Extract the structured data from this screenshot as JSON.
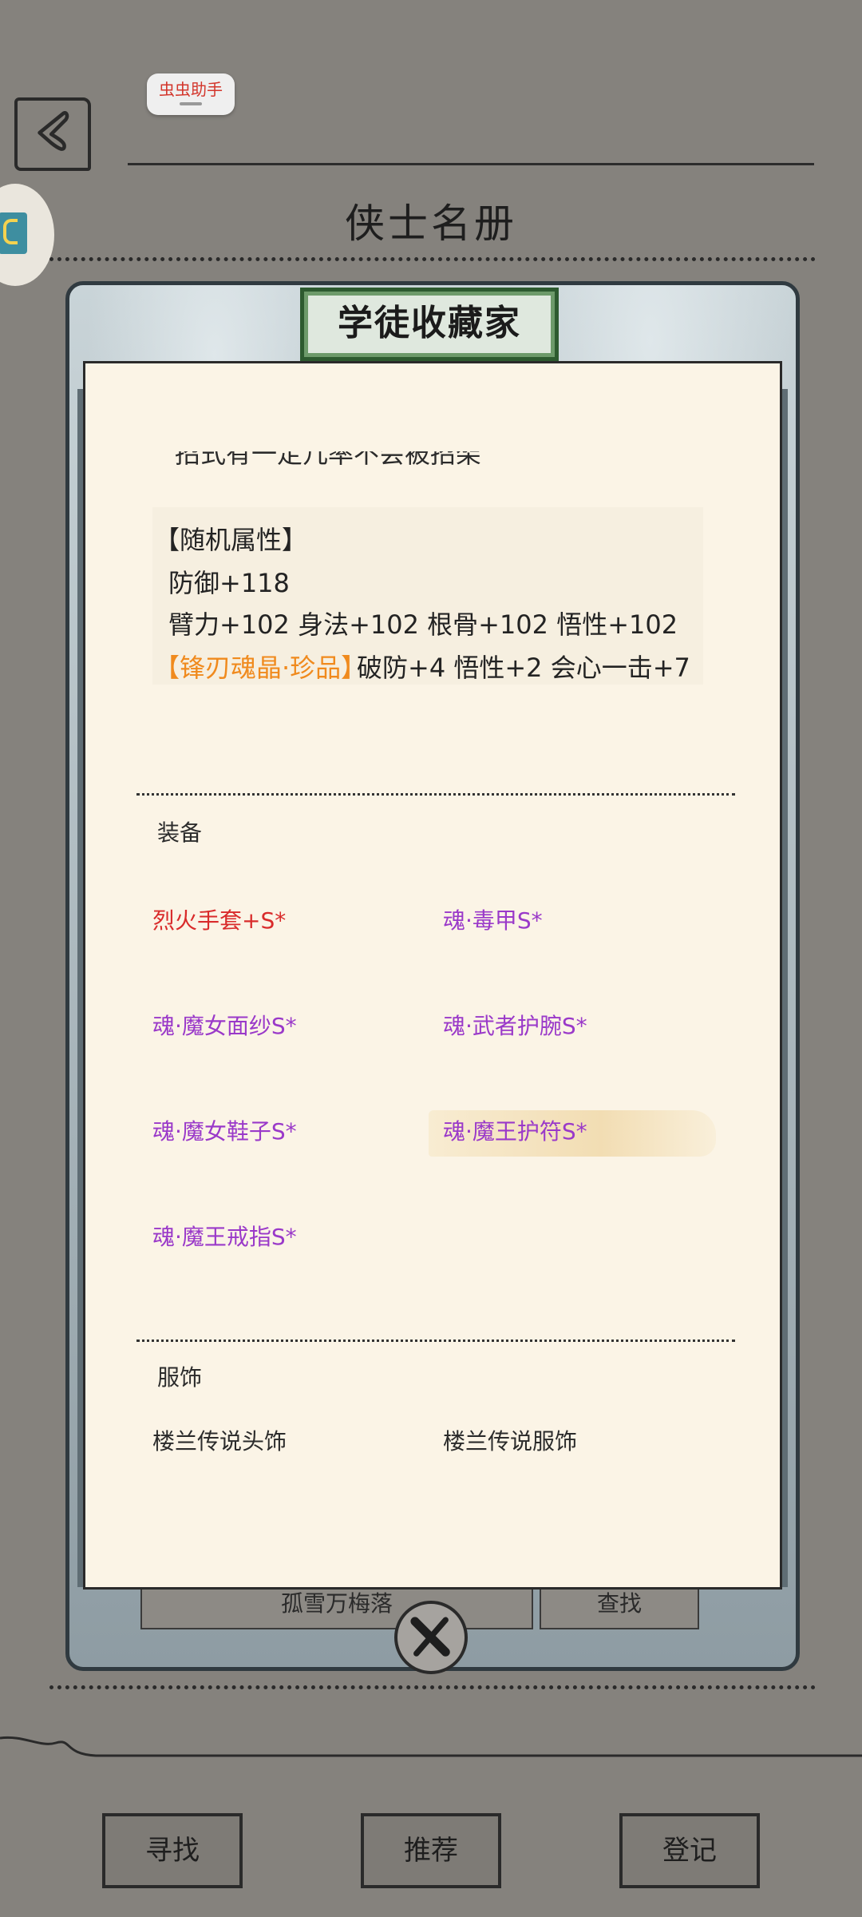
{
  "helper": {
    "label": "虫虫助手"
  },
  "header": {
    "title": "侠士名册"
  },
  "modal": {
    "title": "学徒收藏家",
    "cut_text": "招式有一定几率不会被招架",
    "random_attr": {
      "heading": "【随机属性】",
      "defense": "防御+118",
      "stats": "臂力+102 身法+102 根骨+102 悟性+102",
      "gem_name": "【锋刃魂晶·珍品】",
      "gem_effect": "破防+4 悟性+2 会心一击+7"
    },
    "equipment": {
      "label": "装备",
      "items": [
        "烈火手套+S*",
        "魂·毒甲S*",
        "魂·魔女面纱S*",
        "魂·武者护腕S*",
        "魂·魔女鞋子S*",
        "魂·魔王护符S*",
        "魂·魔王戒指S*"
      ]
    },
    "clothing": {
      "label": "服饰",
      "items": [
        "楼兰传说头饰",
        "楼兰传说服饰"
      ]
    }
  },
  "search": {
    "value": "孤雪万梅落",
    "button": "查找"
  },
  "bottom_nav": {
    "find": "寻找",
    "recommend": "推荐",
    "register": "登记"
  },
  "colors": {
    "background": "#85827d",
    "paper": "#fbf4e6",
    "orange": "#f08a1d",
    "purple": "#9a39c9",
    "red": "#d92b2b"
  }
}
